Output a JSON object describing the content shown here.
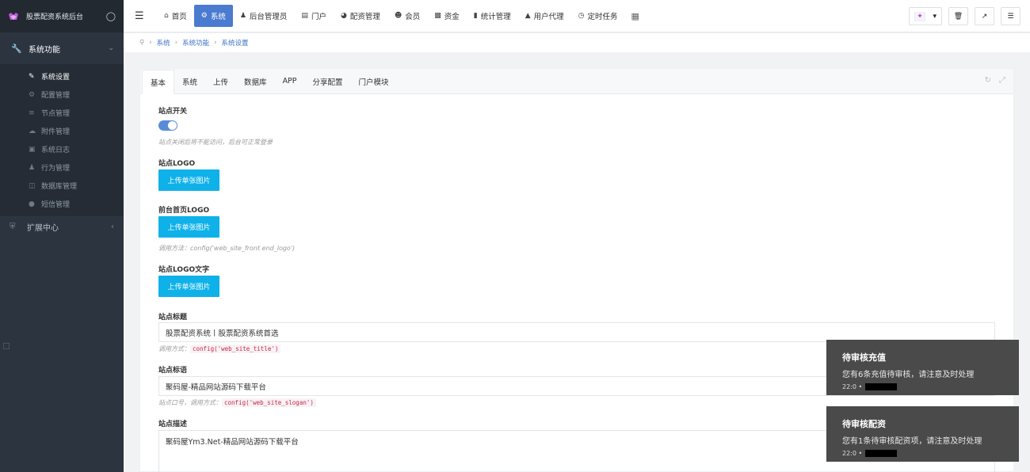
{
  "brand": {
    "title": "股票配资系统后台"
  },
  "sidebar": {
    "section": {
      "label": "系统功能",
      "icon": "wrench-icon"
    },
    "items": [
      {
        "label": "系统设置",
        "icon": "wrench-icon",
        "active": true
      },
      {
        "label": "配置管理",
        "icon": "gears-icon"
      },
      {
        "label": "节点管理",
        "icon": "list-icon"
      },
      {
        "label": "附件管理",
        "icon": "cloud-upload-icon"
      },
      {
        "label": "系统日志",
        "icon": "book-icon"
      },
      {
        "label": "行为管理",
        "icon": "user-secret-icon"
      },
      {
        "label": "数据库管理",
        "icon": "database-icon"
      },
      {
        "label": "短信管理",
        "icon": "map-marker-icon"
      }
    ],
    "ext": {
      "label": "扩展中心",
      "icon": "shield-icon"
    }
  },
  "topnav": {
    "items": [
      {
        "label": "首页",
        "icon": "home-icon"
      },
      {
        "label": "系统",
        "icon": "gear-icon",
        "active": true
      },
      {
        "label": "后台管理员",
        "icon": "user-icon"
      },
      {
        "label": "门户",
        "icon": "id-card-icon"
      },
      {
        "label": "配资管理",
        "icon": "pie-chart-icon"
      },
      {
        "label": "会员",
        "icon": "users-icon"
      },
      {
        "label": "资金",
        "icon": "money-icon"
      },
      {
        "label": "统计管理",
        "icon": "bar-chart-icon"
      },
      {
        "label": "用户代理",
        "icon": "sitemap-icon"
      },
      {
        "label": "定时任务",
        "icon": "clock-icon"
      }
    ]
  },
  "breadcrumb": [
    "系统",
    "系统功能",
    "系统设置"
  ],
  "tabs": [
    "基本",
    "系统",
    "上传",
    "数据库",
    "APP",
    "分享配置",
    "门户模块"
  ],
  "form": {
    "site_switch": {
      "label": "站点开关",
      "help": "站点关闭后将不能访问，后台可正常登录",
      "value": true
    },
    "site_logo": {
      "label": "站点LOGO",
      "button": "上传单张图片"
    },
    "front_logo": {
      "label": "前台首页LOGO",
      "button": "上传单张图片",
      "help": "调用方法：config('web_site_front end_logo')"
    },
    "logo_text": {
      "label": "站点LOGO文字",
      "button": "上传单张图片"
    },
    "site_title": {
      "label": "站点标题",
      "value": "股票配资系统丨股票配资系统首选",
      "help": "调用方式：",
      "code": "config('web_site_title')"
    },
    "site_slogan": {
      "label": "站点标语",
      "value": "聚码屋-精品网站源码下载平台",
      "help": "站点口号，调用方式：",
      "code": "config('web_site_slogan')"
    },
    "site_desc": {
      "label": "站点描述",
      "value": "聚码屋Ym3.Net-精品网站源码下载平台"
    }
  },
  "notifications": [
    {
      "title": "待审核充值",
      "message": "您有6条充值待审核，请注意及时处理",
      "time": "22:0 •"
    },
    {
      "title": "待审核配资",
      "message": "您有1条待审核配资项，请注意及时处理",
      "time": "22:0 •"
    }
  ]
}
